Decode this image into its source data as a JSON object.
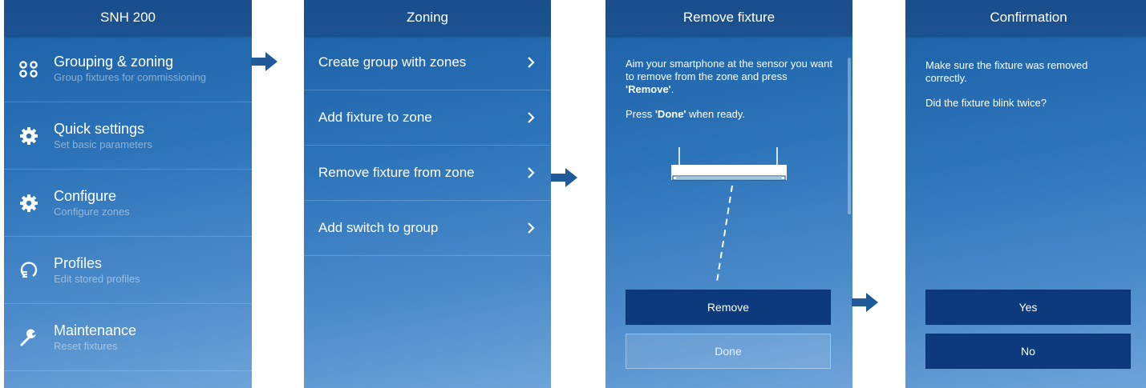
{
  "screen1": {
    "title": "SNH 200",
    "items": [
      {
        "icon": "grouping-icon",
        "title": "Grouping & zoning",
        "sub": "Group fixtures for commissioning"
      },
      {
        "icon": "gear-icon",
        "title": "Quick settings",
        "sub": "Set basic parameters"
      },
      {
        "icon": "gear-icon",
        "title": "Configure",
        "sub": "Configure zones"
      },
      {
        "icon": "profile-icon",
        "title": "Profiles",
        "sub": "Edit stored profiles"
      },
      {
        "icon": "wrench-icon",
        "title": "Maintenance",
        "sub": "Reset fixtures"
      }
    ]
  },
  "screen2": {
    "title": "Zoning",
    "items": [
      {
        "label": "Create group with zones"
      },
      {
        "label": "Add fixture to zone"
      },
      {
        "label": "Remove fixture from zone"
      },
      {
        "label": "Add switch to group"
      }
    ]
  },
  "screen3": {
    "title": "Remove fixture",
    "instruction_pre": "Aim your smartphone at the sensor you want to remove from the zone and press ",
    "instruction_bold": "'Remove'",
    "instruction_post": ".",
    "done_pre": "Press ",
    "done_bold": "'Done'",
    "done_post": " when ready.",
    "remove_button": "Remove",
    "done_button": "Done"
  },
  "screen4": {
    "title": "Confirmation",
    "text1": "Make sure the fixture was removed correctly.",
    "text2": "Did the fixture blink twice?",
    "yes_button": "Yes",
    "no_button": "No"
  },
  "colors": {
    "header": "#1a4e8d",
    "primary_button": "#0d3a7c",
    "arrow": "#1f5b9b"
  }
}
